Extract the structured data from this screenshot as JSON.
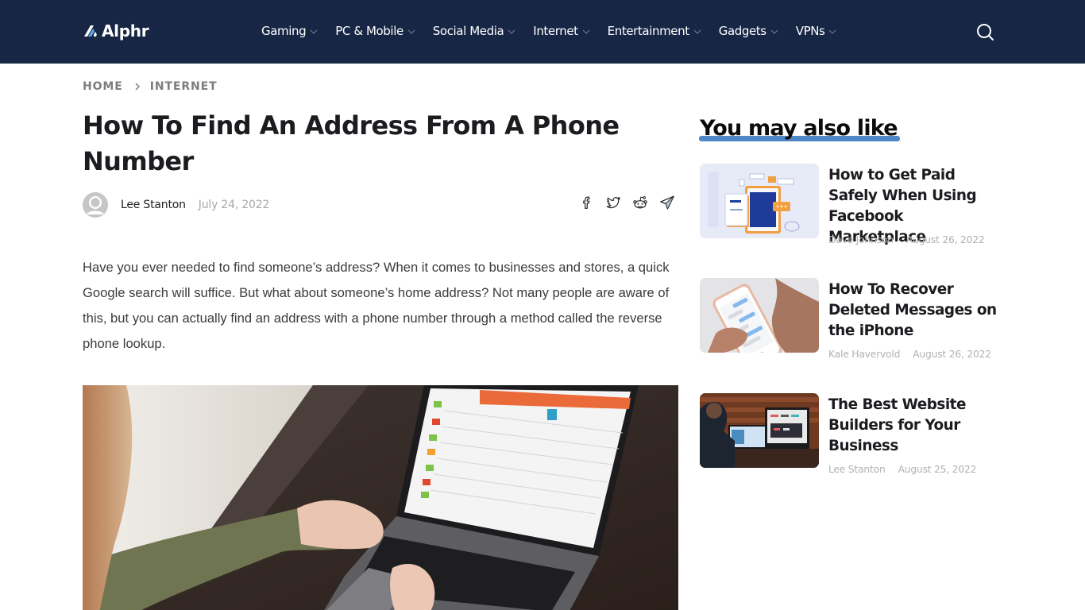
{
  "site": {
    "brand": "Alphr",
    "colors": {
      "header_bg": "#172645",
      "accent_underline": "#4e86c8"
    }
  },
  "nav": {
    "items": [
      {
        "label": "Gaming"
      },
      {
        "label": "PC & Mobile"
      },
      {
        "label": "Social Media"
      },
      {
        "label": "Internet"
      },
      {
        "label": "Entertainment"
      },
      {
        "label": "Gadgets"
      },
      {
        "label": "VPNs"
      }
    ],
    "search_icon": "search-icon"
  },
  "breadcrumb": {
    "items": [
      "HOME",
      "INTERNET"
    ]
  },
  "article": {
    "title": "How To Find An Address From A Phone Number",
    "author": "Lee Stanton",
    "date": "July 24, 2022",
    "share_icons": [
      "facebook-icon",
      "twitter-icon",
      "reddit-icon",
      "telegram-icon"
    ],
    "intro": "Have you ever needed to find someone’s address? When it comes to businesses and stores, a quick Google search will suffice. But what about someone’s home address? Not many people are aware of this, but you can actually find an address with a phone number through a method called the reverse phone lookup.",
    "hero_image": "Person typing on a laptop showing a reverse phone lookup results page"
  },
  "sidebar": {
    "title": "You may also like",
    "cards": [
      {
        "title": "How to Get Paid Safely When Using Facebook Marketplace",
        "author": "Dave Johnson",
        "date": "August 26, 2022",
        "thumb": "Illustration of tablet marketplace"
      },
      {
        "title": "How To Recover Deleted Messages on the iPhone",
        "author": "Kale Havervold",
        "date": "August 26, 2022",
        "thumb": "Hand holding iPhone with messages"
      },
      {
        "title": "The Best Website Builders for Your Business",
        "author": "Lee Stanton",
        "date": "August 25, 2022",
        "thumb": "Man working at desktop computers"
      }
    ]
  }
}
